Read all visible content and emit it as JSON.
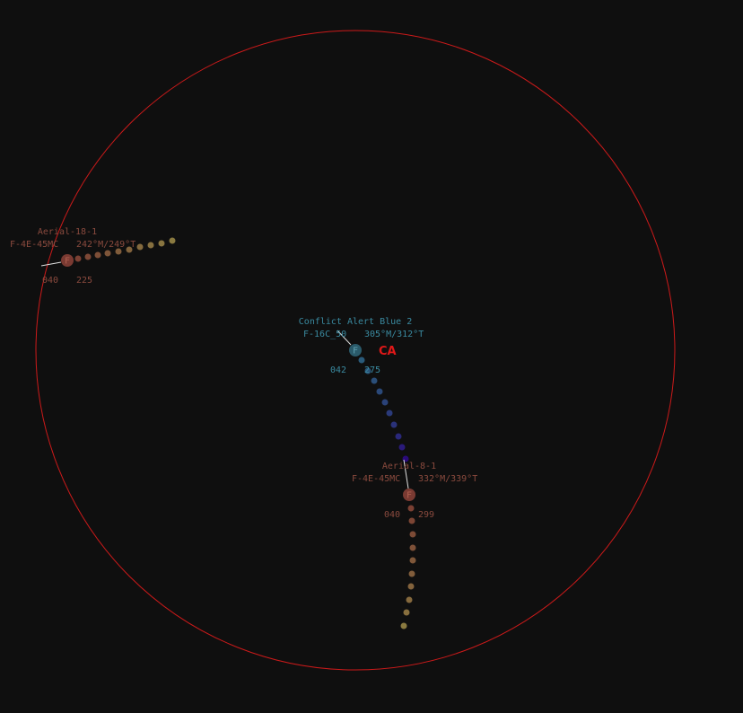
{
  "colors": {
    "background": "#0f0f0f",
    "range_ring": "#cc1a1a",
    "hostile": "#7a3a32",
    "hostile_text": "#8a4a3e",
    "friendly": "#2a5a6a",
    "friendly_text": "#3a8aa0",
    "leader_line": "#e0e0e0",
    "alert": "#e01818",
    "trail_old": "#8a7a40",
    "trail_new_hostile": "#7a3a32",
    "trail_new_friendly": "#2a4a7a",
    "trail_end_friendly": "#2a0a7a"
  },
  "contacts": [
    {
      "id": "hostile-1",
      "callsign": "Aerial-18-1",
      "type_label": "F-4E-45MC",
      "heading": "242°M/249°T",
      "altitude": "040",
      "speed": "225",
      "symbol": "F",
      "side": "hostile"
    },
    {
      "id": "friendly-1",
      "callsign": "Conflict Alert Blue 2",
      "type_label": "F-16C_50",
      "heading": "305°M/312°T",
      "altitude": "042",
      "speed": "275",
      "symbol": "F",
      "side": "friendly",
      "alert": "CA"
    },
    {
      "id": "hostile-2",
      "callsign": "Aerial-8-1",
      "type_label": "F-4E-45MC",
      "heading": "332°M/339°T",
      "altitude": "040",
      "speed": "299",
      "symbol": "F",
      "side": "hostile"
    }
  ]
}
